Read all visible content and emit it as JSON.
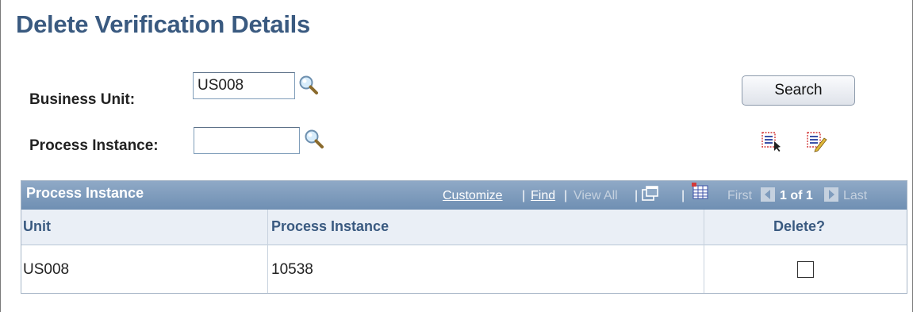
{
  "page": {
    "title": "Delete Verification Details"
  },
  "form": {
    "business_unit_label": "Business Unit:",
    "business_unit_value": "US008",
    "process_instance_label": "Process Instance:",
    "process_instance_value": "",
    "search_label": "Search"
  },
  "grid": {
    "title": "Process Instance",
    "nav": {
      "customize": "Customize",
      "sep": "|",
      "find": "Find",
      "view_all": "View All",
      "first": "First",
      "page_info": "1 of 1",
      "last": "Last"
    },
    "columns": [
      "Unit",
      "Process Instance",
      "Delete?"
    ],
    "rows": [
      {
        "unit": "US008",
        "process_instance": "10538",
        "delete": false
      }
    ]
  },
  "icons": {
    "lookup": "magnifier-lookup-icon",
    "select_all": "select-all-icon",
    "deselect_all": "deselect-all-icon",
    "zoom": "new-window-icon",
    "download": "download-grid-icon",
    "prev": "prev-arrow-icon",
    "next": "next-arrow-icon"
  },
  "colors": {
    "title": "#3a5a80",
    "grid_header": "#7f9cbd",
    "column_header_bg": "#eaeff6"
  }
}
